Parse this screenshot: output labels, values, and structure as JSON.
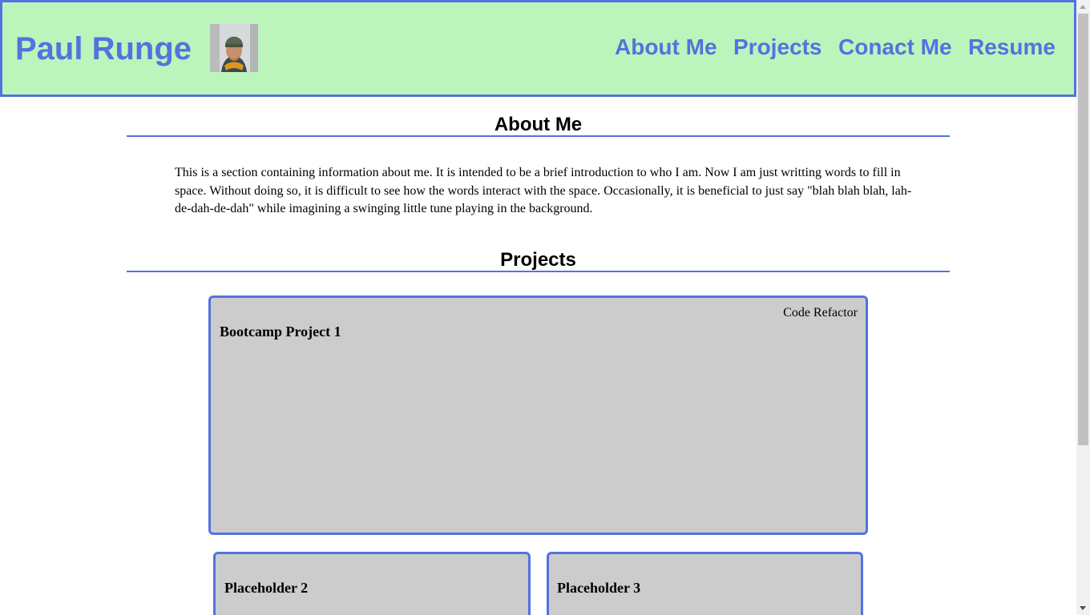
{
  "header": {
    "site_title": "Paul Runge",
    "avatar_alt": "Paul Runge portrait",
    "nav": [
      "About Me",
      "Projects",
      "Conact Me",
      "Resume"
    ]
  },
  "about": {
    "heading": "About Me",
    "body": "This is a section containing information about me. It is intended to be a brief introduction to who I am. Now I am just writting words to fill in space. Without doing so, it is difficult to see how the words interact with the space. Occasionally, it is beneficial to just say \"blah blah blah, lah-de-dah-de-dah\" while imagining a swinging little tune playing in the background."
  },
  "projects": {
    "heading": "Projects",
    "cards": [
      {
        "title": "Bootcamp Project 1",
        "link": "Code Refactor"
      },
      {
        "title": "Placeholder 2"
      },
      {
        "title": "Placeholder 3"
      }
    ]
  },
  "colors": {
    "accent": "#5472e0",
    "header_bg": "#bdf4bc",
    "card_bg": "#cccccc"
  }
}
